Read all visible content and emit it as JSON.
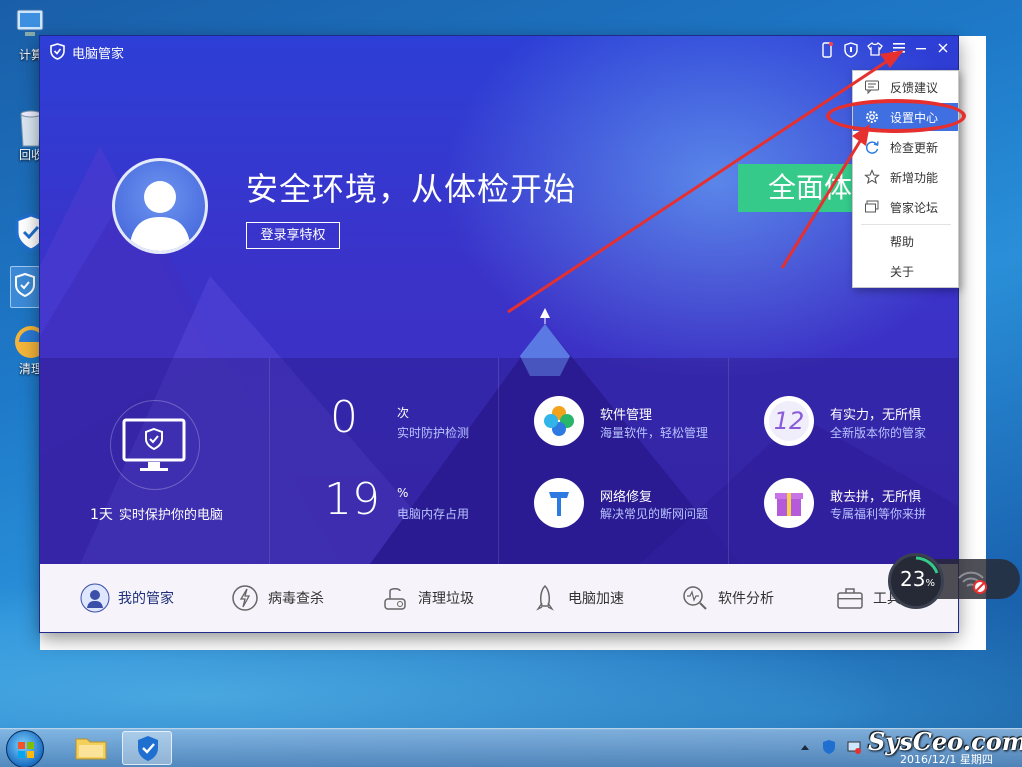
{
  "desktop": {
    "icons": [
      {
        "label": "计算"
      },
      {
        "label": "回收"
      },
      {
        "label": ""
      },
      {
        "label": "清理"
      }
    ]
  },
  "window": {
    "title": "电脑管家",
    "hero": {
      "title": "安全环境，从体检开始",
      "login_button": "登录享特权",
      "scan_button": "全面体"
    },
    "stats": {
      "days_num": "1天",
      "days_text": "实时保护你的电脑",
      "detections_value": "0",
      "detections_unit": "次",
      "detections_desc": "实时防护检测",
      "memory_value": "19",
      "memory_unit": "%",
      "memory_desc": "电脑内存占用"
    },
    "features": [
      {
        "title": "软件管理",
        "desc": "海量软件，轻松管理",
        "icon": "software-icon"
      },
      {
        "title": "有实力，无所惧",
        "desc": "全新版本你的管家",
        "icon": "badge-12-icon"
      },
      {
        "title": "网络修复",
        "desc": "解决常见的断网问题",
        "icon": "network-repair-icon"
      },
      {
        "title": "敢去拼，无所惧",
        "desc": "专属福利等你来拼",
        "icon": "gift-icon"
      }
    ],
    "nav": [
      {
        "label": "我的管家",
        "icon": "user-icon"
      },
      {
        "label": "病毒查杀",
        "icon": "virus-scan-icon"
      },
      {
        "label": "清理垃圾",
        "icon": "clean-icon"
      },
      {
        "label": "电脑加速",
        "icon": "rocket-icon"
      },
      {
        "label": "软件分析",
        "icon": "analysis-icon"
      },
      {
        "label": "工具箱",
        "icon": "toolbox-icon"
      }
    ]
  },
  "menu": {
    "items": [
      {
        "label": "反馈建议",
        "icon": "feedback-icon"
      },
      {
        "label": "设置中心",
        "icon": "gear-icon"
      },
      {
        "label": "检查更新",
        "icon": "refresh-icon"
      },
      {
        "label": "新增功能",
        "icon": "star-icon"
      },
      {
        "label": "管家论坛",
        "icon": "forum-icon"
      },
      {
        "label": "帮助",
        "icon": ""
      },
      {
        "label": "关于",
        "icon": ""
      }
    ]
  },
  "widget": {
    "percent": "23",
    "unit": "%"
  },
  "taskbar": {
    "clock_date": "2016/12/1 星期四"
  },
  "watermark": "SysCeo.com",
  "colors": {
    "accent": "#3f6fe0",
    "highlight_ring": "#e63030",
    "scan_green": "#35c98a"
  }
}
